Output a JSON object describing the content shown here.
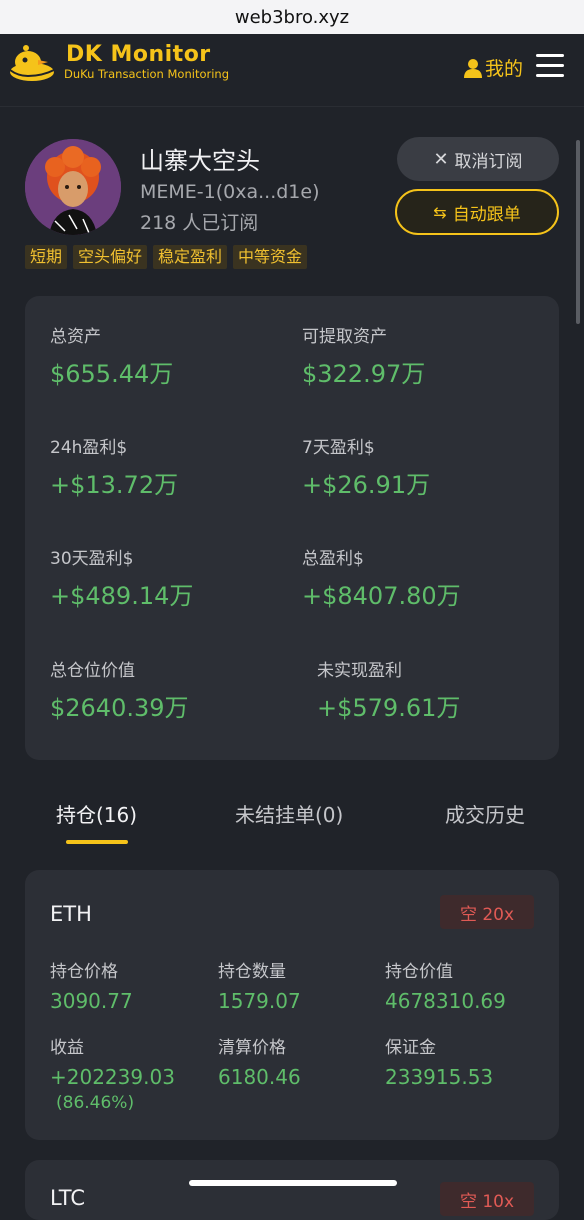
{
  "browser": {
    "url": "web3bro.xyz"
  },
  "header": {
    "brand_title": "DK  Monitor",
    "brand_subtitle": "DuKu Transaction Monitoring",
    "mine_label": "我的",
    "icons": {
      "logo": "dk-duck-logo",
      "user": "user-icon",
      "menu": "hamburger-menu-icon"
    }
  },
  "profile": {
    "name": "山寨大空头",
    "address": "MEME-1(0xa...d1e)",
    "subscribers": "218 人已订阅",
    "unsubscribe_label": "取消订阅",
    "auto_follow_label": "自动跟单",
    "tags": [
      "短期",
      "空头偏好",
      "稳定盈利",
      "中等资金"
    ]
  },
  "stats": [
    {
      "label": "总资产",
      "value": "$655.44万"
    },
    {
      "label": "可提取资产",
      "value": "$322.97万"
    },
    {
      "label": "24h盈利$",
      "value": "+$13.72万"
    },
    {
      "label": "7天盈利$",
      "value": "+$26.91万"
    },
    {
      "label": "30天盈利$",
      "value": "+$489.14万"
    },
    {
      "label": "总盈利$",
      "value": "+$8407.80万"
    },
    {
      "label": "总仓位价值",
      "value": "$2640.39万"
    },
    {
      "label": "未实现盈利",
      "value": "+$579.61万"
    }
  ],
  "tabs": [
    {
      "label": "持仓(16)",
      "active": true
    },
    {
      "label": "未结挂单(0)",
      "active": false
    },
    {
      "label": "成交历史",
      "active": false
    }
  ],
  "positions": [
    {
      "symbol": "ETH",
      "badge": "空 20x",
      "fields": [
        {
          "label": "持仓价格",
          "value": "3090.77"
        },
        {
          "label": "持仓数量",
          "value": "1579.07"
        },
        {
          "label": "持仓价值",
          "value": "4678310.69"
        },
        {
          "label": "收益",
          "value": "+202239.03",
          "sub": "(86.46%)"
        },
        {
          "label": "清算价格",
          "value": "6180.46"
        },
        {
          "label": "保证金",
          "value": "233915.53"
        }
      ]
    },
    {
      "symbol": "LTC",
      "badge": "空 10x"
    }
  ],
  "colors": {
    "accent": "#f5c31a",
    "profit": "#5fbd6a",
    "short": "#e05a55",
    "bg": "#202329",
    "card": "#2c2f36"
  }
}
